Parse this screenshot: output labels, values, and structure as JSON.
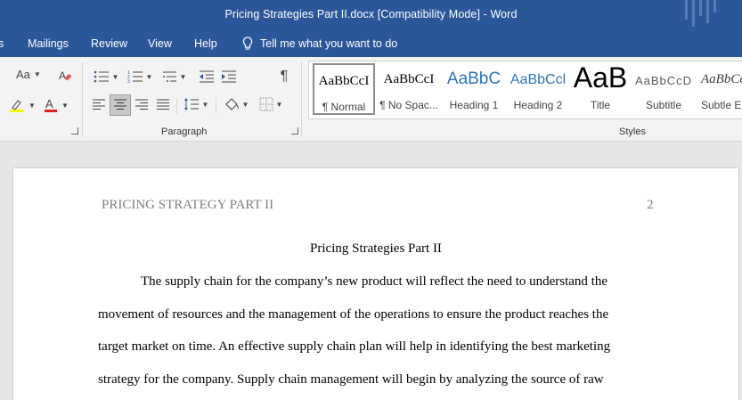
{
  "window": {
    "title": "Pricing Strategies Part II.docx [Compatibility Mode]  -  Word"
  },
  "menu": {
    "tabs": [
      "s",
      "Mailings",
      "Review",
      "View",
      "Help"
    ],
    "tell_me": "Tell me what you want to do"
  },
  "ribbon": {
    "font_case_label": "Aa",
    "paragraph_label": "Paragraph",
    "styles_label": "Styles",
    "pilcrow": "¶",
    "styles": [
      {
        "sample": "AaBbCcI",
        "name": "¶ Normal",
        "selected": true
      },
      {
        "sample": "AaBbCcI",
        "name": "¶ No Spac..."
      },
      {
        "sample": "AaBbC",
        "name": "Heading 1"
      },
      {
        "sample": "AaBbCcl",
        "name": "Heading 2"
      },
      {
        "sample": "AaB",
        "name": "Title"
      },
      {
        "sample": "AaBbCcD",
        "name": "Subtitle"
      },
      {
        "sample": "AaBbCc",
        "name": "Subtle Em"
      }
    ]
  },
  "document": {
    "running_head": "PRICING STRATEGY PART II",
    "page_number": "2",
    "title": "Pricing Strategies Part II",
    "lines": [
      "The supply chain for the company’s new product will reflect the need to understand the",
      "movement of resources and the management of the operations to ensure the product reaches the",
      "target market on time. An effective supply chain plan will help in identifying the best marketing",
      "strategy for the company. Supply chain management will begin by analyzing the source of raw"
    ]
  },
  "colors": {
    "accent": "#2b579a",
    "ribbon_bg": "#f3f3f3",
    "heading_blue": "#2e74b5"
  }
}
